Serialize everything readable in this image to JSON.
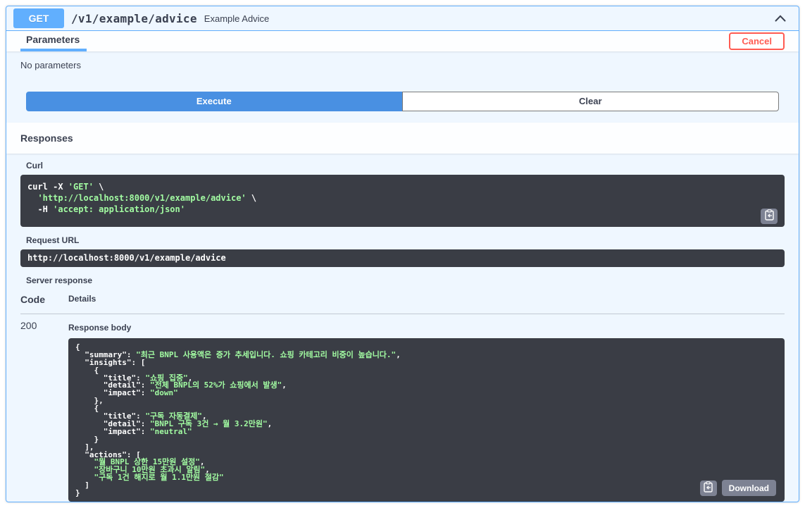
{
  "colors": {
    "accent_blue": "#61affe",
    "execute_blue": "#4990e2",
    "cancel_red": "#ff5b52",
    "code_bg": "#3a3d45",
    "string_green": "#a2fca2",
    "text": "#3b4151",
    "button_gray": "#7d8293"
  },
  "endpoint": {
    "method": "GET",
    "path": "/v1/example/advice",
    "summary": "Example Advice"
  },
  "parameters_section": {
    "title": "Parameters",
    "cancel_label": "Cancel",
    "empty_text": "No parameters",
    "execute_label": "Execute",
    "clear_label": "Clear"
  },
  "responses_section": {
    "title": "Responses",
    "curl_label": "Curl",
    "curl_lines": [
      [
        [
          "w",
          "curl -X "
        ],
        [
          "g",
          "'GET'"
        ],
        [
          "w",
          " \\"
        ]
      ],
      [
        [
          "g",
          "  'http://localhost:8000/v1/example/advice'"
        ],
        [
          "w",
          " \\"
        ]
      ],
      [
        [
          "w",
          "  -H "
        ],
        [
          "g",
          "'accept: application/json'"
        ]
      ]
    ],
    "request_url_label": "Request URL",
    "request_url": "http://localhost:8000/v1/example/advice",
    "server_response_label": "Server response",
    "table": {
      "code_header": "Code",
      "details_header": "Details"
    },
    "response": {
      "code": "200",
      "body_label": "Response body",
      "body_lines": [
        [
          [
            "w",
            "{"
          ]
        ],
        [
          [
            "w",
            "  \"summary\": "
          ],
          [
            "g",
            "\"최근 BNPL 사용액은 증가 추세입니다. 쇼핑 카테고리 비중이 높습니다.\""
          ],
          [
            "w",
            ","
          ]
        ],
        [
          [
            "w",
            "  \"insights\": ["
          ]
        ],
        [
          [
            "w",
            "    {"
          ]
        ],
        [
          [
            "w",
            "      \"title\": "
          ],
          [
            "g",
            "\"쇼핑 집중\""
          ],
          [
            "w",
            ","
          ]
        ],
        [
          [
            "w",
            "      \"detail\": "
          ],
          [
            "g",
            "\"전체 BNPL의 52%가 쇼핑에서 발생\""
          ],
          [
            "w",
            ","
          ]
        ],
        [
          [
            "w",
            "      \"impact\": "
          ],
          [
            "g",
            "\"down\""
          ]
        ],
        [
          [
            "w",
            "    },"
          ]
        ],
        [
          [
            "w",
            "    {"
          ]
        ],
        [
          [
            "w",
            "      \"title\": "
          ],
          [
            "g",
            "\"구독 자동결제\""
          ],
          [
            "w",
            ","
          ]
        ],
        [
          [
            "w",
            "      \"detail\": "
          ],
          [
            "g",
            "\"BNPL 구독 3건 → 월 3.2만원\""
          ],
          [
            "w",
            ","
          ]
        ],
        [
          [
            "w",
            "      \"impact\": "
          ],
          [
            "g",
            "\"neutral\""
          ]
        ],
        [
          [
            "w",
            "    }"
          ]
        ],
        [
          [
            "w",
            "  ],"
          ]
        ],
        [
          [
            "w",
            "  \"actions\": ["
          ]
        ],
        [
          [
            "w",
            "    "
          ],
          [
            "g",
            "\"월 BNPL 상한 15만원 설정\""
          ],
          [
            "w",
            ","
          ]
        ],
        [
          [
            "w",
            "    "
          ],
          [
            "g",
            "\"장바구니 10만원 초과시 알림\""
          ],
          [
            "w",
            ","
          ]
        ],
        [
          [
            "w",
            "    "
          ],
          [
            "g",
            "\"구독 1건 해지로 월 1.1만원 절감\""
          ]
        ],
        [
          [
            "w",
            "  ]"
          ]
        ],
        [
          [
            "w",
            "}"
          ]
        ]
      ],
      "download_label": "Download"
    }
  }
}
